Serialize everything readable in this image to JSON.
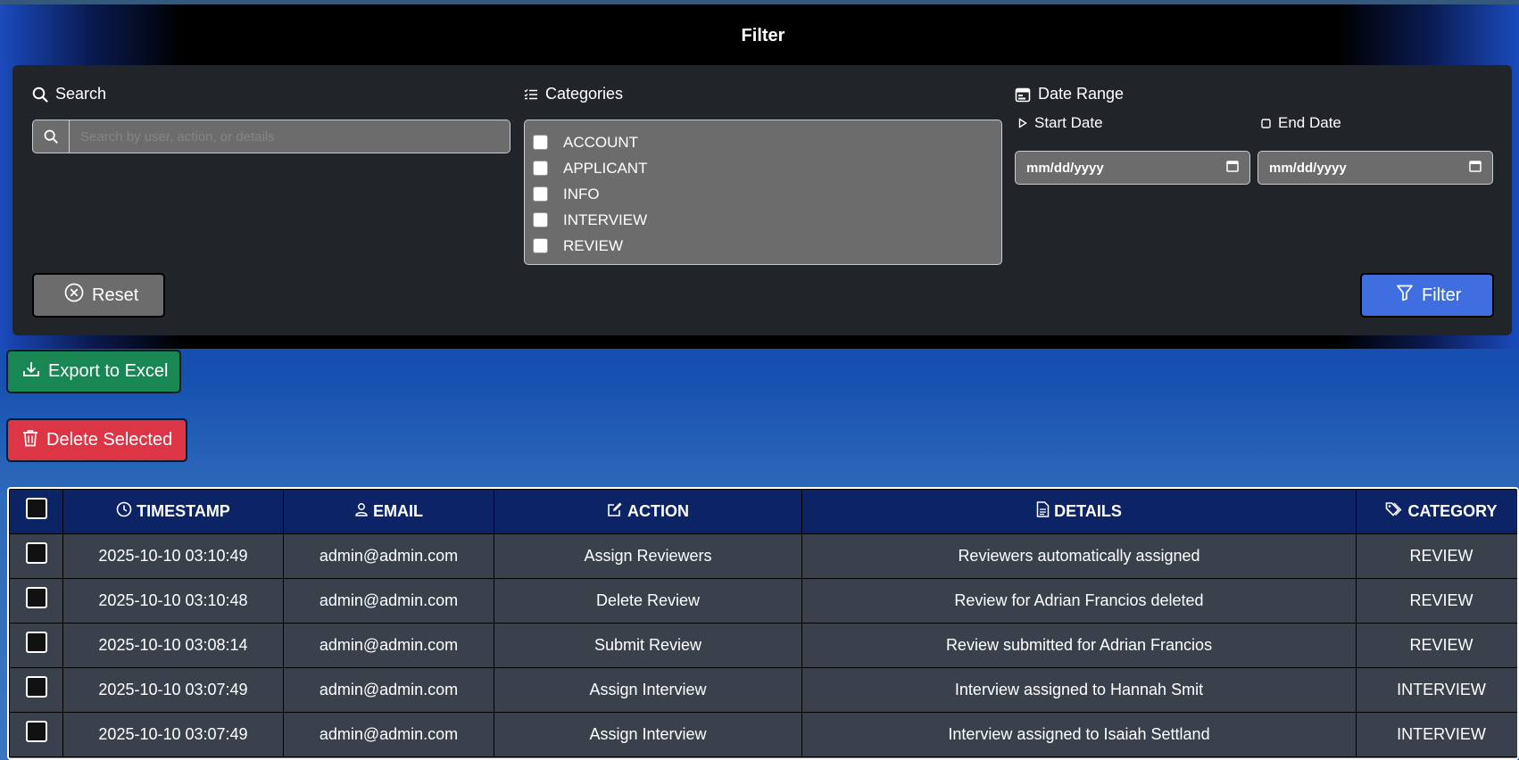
{
  "filter": {
    "title": "Filter",
    "search": {
      "label": "Search",
      "placeholder": "Search by user, action, or details",
      "value": ""
    },
    "categories": {
      "label": "Categories",
      "options": [
        "ACCOUNT",
        "APPLICANT",
        "INFO",
        "INTERVIEW",
        "REVIEW"
      ]
    },
    "date_range": {
      "label": "Date Range",
      "start_label": "Start Date",
      "end_label": "End Date",
      "start_value": "mm/dd/yyyy",
      "end_value": "mm/dd/yyyy"
    },
    "reset_label": "Reset",
    "filter_label": "Filter"
  },
  "actions": {
    "export_label": "Export to Excel",
    "delete_label": "Delete Selected"
  },
  "table": {
    "headers": {
      "timestamp": "TIMESTAMP",
      "email": "EMAIL",
      "action": "ACTION",
      "details": "DETAILS",
      "category": "CATEGORY"
    },
    "rows": [
      {
        "timestamp": "2025-10-10 03:10:49",
        "email": "admin@admin.com",
        "action": "Assign Reviewers",
        "details": "Reviewers automatically assigned",
        "category": "REVIEW"
      },
      {
        "timestamp": "2025-10-10 03:10:48",
        "email": "admin@admin.com",
        "action": "Delete Review",
        "details": "Review for Adrian Francios deleted",
        "category": "REVIEW"
      },
      {
        "timestamp": "2025-10-10 03:08:14",
        "email": "admin@admin.com",
        "action": "Submit Review",
        "details": "Review submitted for Adrian Francios",
        "category": "REVIEW"
      },
      {
        "timestamp": "2025-10-10 03:07:49",
        "email": "admin@admin.com",
        "action": "Assign Interview",
        "details": "Interview assigned to Hannah Smit",
        "category": "INTERVIEW"
      },
      {
        "timestamp": "2025-10-10 03:07:49",
        "email": "admin@admin.com",
        "action": "Assign Interview",
        "details": "Interview assigned to Isaiah Settland",
        "category": "INTERVIEW"
      }
    ]
  }
}
